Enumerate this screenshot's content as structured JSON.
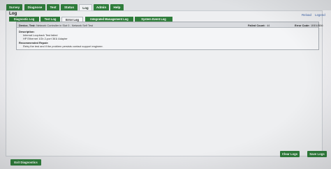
{
  "nav": {
    "tabs": [
      "Survey",
      "Diagnose",
      "Test",
      "Status",
      "Log",
      "Admin",
      "Help"
    ],
    "active": "Log"
  },
  "log": {
    "title": "Log",
    "links": {
      "reload": "Reload",
      "legend": "Legend"
    },
    "sub_tabs": [
      "Diagnostic Log",
      "Test Log",
      "Error Log",
      "Integrated Management Log",
      "System Event Log"
    ],
    "active_sub_tab": "Error Log"
  },
  "entry": {
    "device_test_label": "Device, Test:",
    "device_test_value": "Network Controller in Slot 0 - Network Self Test",
    "failed_count_label": "Failed Count:",
    "failed_count_value": "44",
    "error_code_label": "Error Code:",
    "error_code_value": "1BE4/B56",
    "description_label": "Description:",
    "description_lines": [
      "Internal Loopback Test failed",
      "HP Ethernet 1Gb 2-port 361i Adapter"
    ],
    "repair_label": "Recommended Repair:",
    "repair_text": "Retry the test and if the problem persists contact support engineer."
  },
  "footer": {
    "exit_label": "Exit Diagnostics",
    "clear_label": "Clear Logs",
    "save_label": "Save Logs"
  },
  "colors": {
    "accent": "#2f7d3b",
    "link": "#3d63a8",
    "panel": "#eeeff1"
  }
}
